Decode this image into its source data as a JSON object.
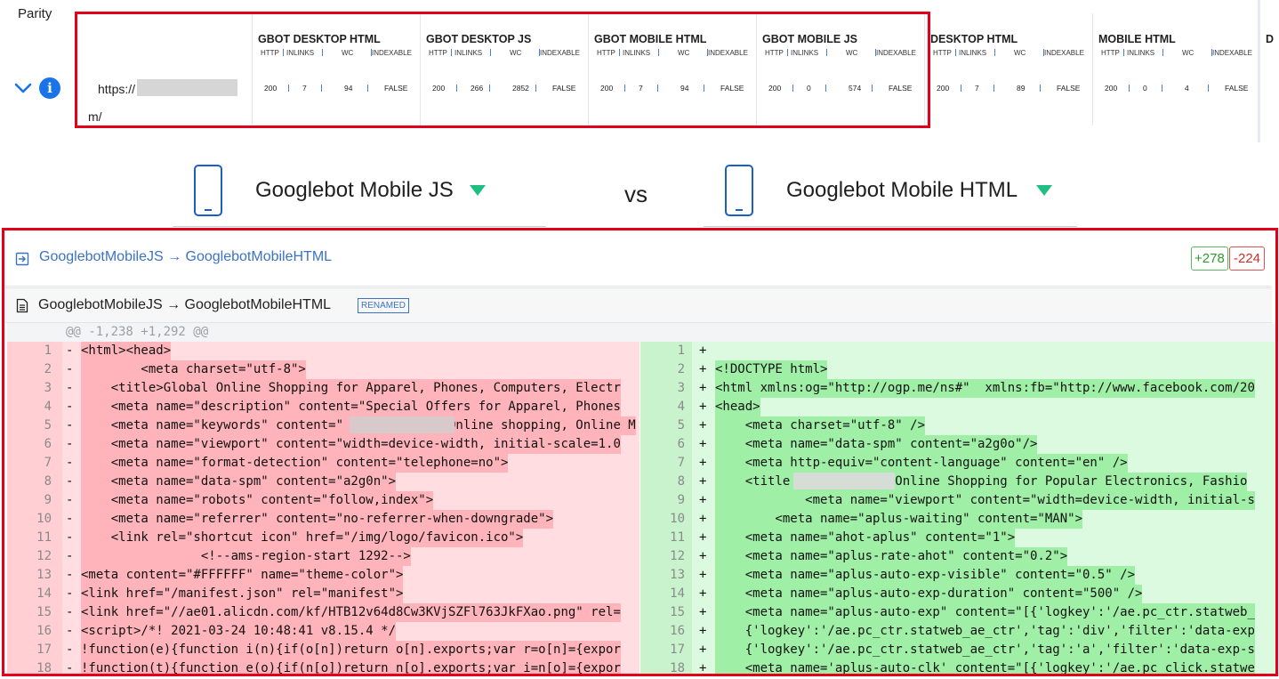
{
  "parity": {
    "label": "Parity",
    "url_prefix": "https://",
    "url_suffix": "m/",
    "columns": [
      {
        "title": "GBOT DESKTOP HTML",
        "http": "200",
        "inlinks": "7",
        "wc": "94",
        "indexable": "FALSE"
      },
      {
        "title": "GBOT DESKTOP JS",
        "http": "200",
        "inlinks": "266",
        "wc": "2852",
        "indexable": "FALSE"
      },
      {
        "title": "GBOT MOBILE HTML",
        "http": "200",
        "inlinks": "7",
        "wc": "94",
        "indexable": "FALSE"
      },
      {
        "title": "GBOT MOBILE JS",
        "http": "200",
        "inlinks": "0",
        "wc": "574",
        "indexable": "FALSE"
      },
      {
        "title": "DESKTOP HTML",
        "http": "200",
        "inlinks": "7",
        "wc": "89",
        "indexable": "FALSE"
      },
      {
        "title": "MOBILE HTML",
        "http": "200",
        "inlinks": "0",
        "wc": "4",
        "indexable": "FALSE"
      },
      {
        "title": "D",
        "http": "",
        "inlinks": "",
        "wc": "",
        "indexable": ""
      }
    ],
    "sub_headers": {
      "http": "HTTP",
      "inlinks": "INLINKS",
      "wc": "WC",
      "indexable": "INDEXABLE"
    }
  },
  "compare": {
    "left": "Googlebot Mobile JS",
    "vs": "vs",
    "right": "Googlebot Mobile HTML"
  },
  "diff": {
    "file_link": "GooglebotMobileJS → GooglebotMobileHTML",
    "additions": "+278",
    "deletions": "-224",
    "file_title": "GooglebotMobileJS → GooglebotMobileHTML",
    "renamed_badge": "RENAMED",
    "hunk": "@@ -1,238 +1,292 @@",
    "left_lines": [
      {
        "n": "1",
        "code": "<html><head>"
      },
      {
        "n": "2",
        "code": "        <meta charset=\"utf-8\">"
      },
      {
        "n": "3",
        "code": "    <title>Global Online Shopping for Apparel, Phones, Computers, Electr"
      },
      {
        "n": "4",
        "code": "    <meta name=\"description\" content=\"Special Offers for Apparel, Phones"
      },
      {
        "n": "5",
        "code": "    <meta name=\"keywords\" content=\"              Online shopping, Online M"
      },
      {
        "n": "6",
        "code": "    <meta name=\"viewport\" content=\"width=device-width, initial-scale=1.0"
      },
      {
        "n": "7",
        "code": "    <meta name=\"format-detection\" content=\"telephone=no\">"
      },
      {
        "n": "8",
        "code": "    <meta name=\"data-spm\" content=\"a2g0n\">"
      },
      {
        "n": "9",
        "code": "    <meta name=\"robots\" content=\"follow,index\">"
      },
      {
        "n": "10",
        "code": "    <meta name=\"referrer\" content=\"no-referrer-when-downgrade\">"
      },
      {
        "n": "11",
        "code": "    <link rel=\"shortcut icon\" href=\"/img/logo/favicon.ico\">"
      },
      {
        "n": "12",
        "code": "                <!--ams-region-start 1292-->"
      },
      {
        "n": "13",
        "code": "<meta content=\"#FFFFFF\" name=\"theme-color\">"
      },
      {
        "n": "14",
        "code": "<link href=\"/manifest.json\" rel=\"manifest\">"
      },
      {
        "n": "15",
        "code": "<link href=\"//ae01.alicdn.com/kf/HTB12v64d8Cw3KVjSZFl763JkFXao.png\" rel="
      },
      {
        "n": "16",
        "code": "<script>/*! 2021-03-24 10:48:41 v8.15.4 */"
      },
      {
        "n": "17",
        "code": "!function(e){function i(n){if(o[n])return o[n].exports;var r=o[n]={expor"
      },
      {
        "n": "18",
        "code": "!function(t){function e(o){if(n[o])return n[o].exports;var i=n[o]={expor"
      }
    ],
    "right_lines": [
      {
        "n": "1",
        "code": ""
      },
      {
        "n": "2",
        "code": "<!DOCTYPE html>"
      },
      {
        "n": "3",
        "code": "<html xmlns:og=\"http://ogp.me/ns#\"  xmlns:fb=\"http://www.facebook.com/20"
      },
      {
        "n": "4",
        "code": "<head>"
      },
      {
        "n": "5",
        "code": "    <meta charset=\"utf-8\" />"
      },
      {
        "n": "6",
        "code": "    <meta name=\"data-spm\" content=\"a2g0o\"/>"
      },
      {
        "n": "7",
        "code": "    <meta http-equiv=\"content-language\" content=\"en\" />"
      },
      {
        "n": "8",
        "code": "    <title              Online Shopping for Popular Electronics, Fashio"
      },
      {
        "n": "9",
        "code": "            <meta name=\"viewport\" content=\"width=device-width, initial-s"
      },
      {
        "n": "10",
        "code": "        <meta name=\"aplus-waiting\" content=\"MAN\">"
      },
      {
        "n": "11",
        "code": "    <meta name=\"ahot-aplus\" content=\"1\">"
      },
      {
        "n": "12",
        "code": "    <meta name=\"aplus-rate-ahot\" content=\"0.2\">"
      },
      {
        "n": "13",
        "code": "    <meta name=\"aplus-auto-exp-visible\" content=\"0.5\" />"
      },
      {
        "n": "14",
        "code": "    <meta name=\"aplus-auto-exp-duration\" content=\"500\" />"
      },
      {
        "n": "15",
        "code": "    <meta name=\"aplus-auto-exp\" content=\"[{'logkey':'/ae.pc_ctr.statweb_"
      },
      {
        "n": "16",
        "code": "    {'logkey':'/ae.pc_ctr.statweb_ae_ctr','tag':'div','filter':'data-exp"
      },
      {
        "n": "17",
        "code": "    {'logkey':'/ae.pc_ctr.statweb_ae_ctr','tag':'a','filter':'data-exp-s"
      },
      {
        "n": "18",
        "code": "    <meta name='aplus-auto-clk' content=\"[{'logkey':'/ae.pc_click.statwe"
      }
    ],
    "left_marker": "-",
    "right_marker": "+"
  },
  "colors": {
    "highlight_border": "#e2001a",
    "link": "#3b73c4",
    "add": "#2e9a2e",
    "del": "#d12c2c",
    "caret": "#1fbf83",
    "info": "#1a73e8"
  }
}
